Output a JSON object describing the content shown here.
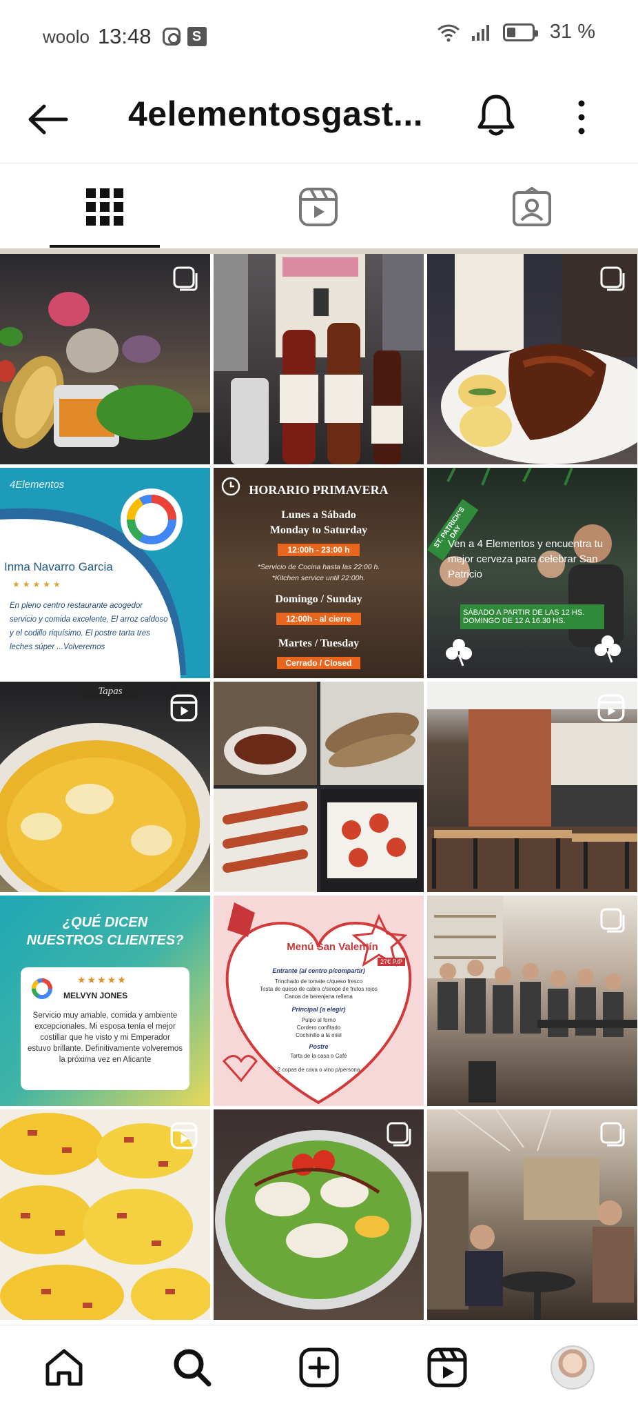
{
  "status_bar": {
    "carrier": "woolo",
    "time": "13:48",
    "notification_badge": "S",
    "battery": "31 %"
  },
  "header": {
    "title": "4elementosgast..."
  },
  "tabs": [
    {
      "name": "posts-grid",
      "icon": "grid-icon",
      "active": true
    },
    {
      "name": "reels",
      "icon": "reels-icon",
      "active": false
    },
    {
      "name": "tagged",
      "icon": "tagged-icon",
      "active": false
    }
  ],
  "posts": {
    "p4": {
      "brand": "4Elementos",
      "name": "Inma Navarro Garcia",
      "stars": "★★★★★",
      "review": "En pleno centro restaurante acogedor servicio y comida excelente, El arroz caldoso y el codillo riquísimo. El postre tarta tres leches súper ...Volveremos"
    },
    "p5": {
      "heading": "HORARIO PRIMAVERA",
      "line1": "Lunes a Sábado",
      "line2": "Monday to Saturday",
      "hours1": "12:00h - 23:00 h",
      "note1": "*Servicio de Cocina hasta las 22:00 h.",
      "note2": "*Kitchen service until 22:00h.",
      "line3": "Domingo / Sunday",
      "hours2": "12:00h - al cierre",
      "line4": "Martes / Tuesday",
      "closed": "Cerrado / Closed"
    },
    "p6": {
      "ribbon": "ST. PATRICK'S DAY",
      "text": "Ven a 4 Elementos y encuentra tu mejor cerveza para celebrar San Patricio",
      "banner1": "SÁBADO A PARTIR DE LAS 12 HS.",
      "banner2": "DOMINGO DE 12 A 16.30 HS."
    },
    "p7": {
      "sign": "Tapas"
    },
    "p10": {
      "heading1": "¿QUÉ DICEN",
      "heading2": "NUESTROS CLIENTES?",
      "stars": "★★★★★",
      "name": "MELVYN JONES",
      "review": "Servicio muy amable, comida y ambiente excepcionales. Mi esposa tenía el mejor costillar que he visto y mi Emperador estuvo brillante. Definitivamente volveremos la próxima vez en Alicante"
    },
    "p11": {
      "title": "Menú San Valentín",
      "price": "27€ P/P",
      "s1": "Entrante (al centro p/compartir)",
      "s1a": "Trinchado de tomate c/queso fresco",
      "s1b": "Tosta de queso de cabra c/sirope de frutos rojos",
      "s1c": "Canoa de berenjena rellena",
      "s2": "Principal (a elegir)",
      "s2a": "Pulpo al forno",
      "s2b": "Cordero confitado",
      "s2c": "Cochinillo a la miel",
      "s3": "Postre",
      "s3a": "Tarta de la casa o Café",
      "s4": "2 copas de cava o vino p/persona"
    }
  },
  "bottom_nav": [
    {
      "name": "home",
      "icon": "home-icon"
    },
    {
      "name": "search",
      "icon": "search-icon"
    },
    {
      "name": "create",
      "icon": "plus-square-icon"
    },
    {
      "name": "reels",
      "icon": "reels-icon"
    },
    {
      "name": "profile",
      "icon": "avatar"
    }
  ]
}
